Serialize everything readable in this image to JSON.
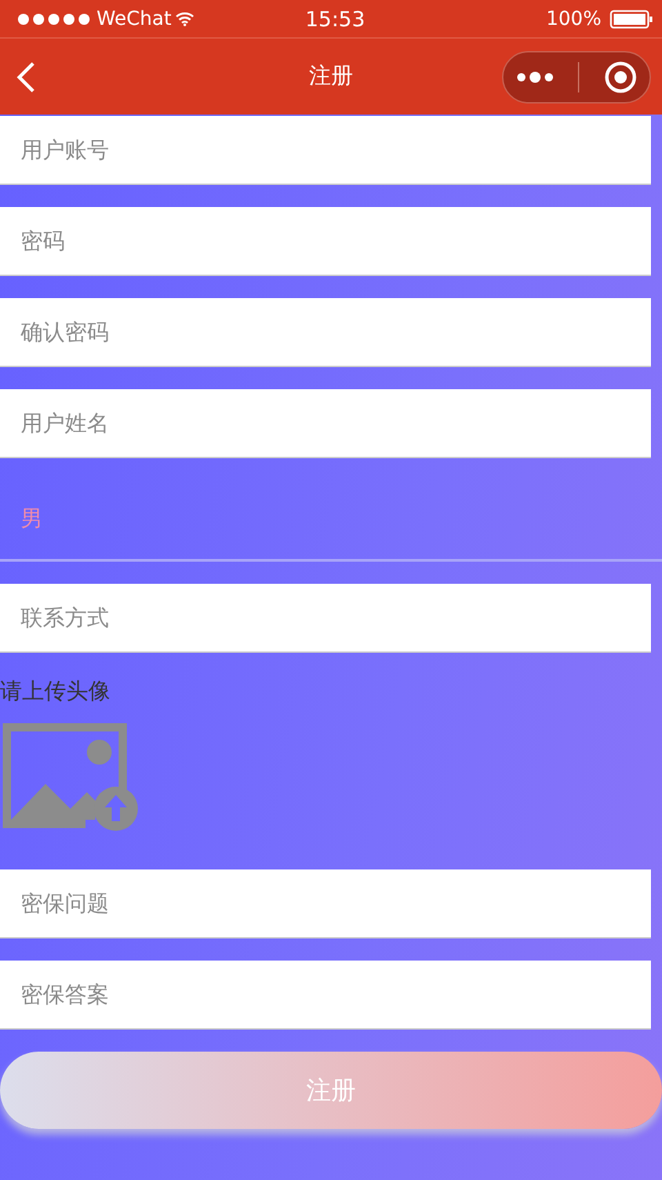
{
  "status_bar": {
    "carrier": "WeChat",
    "time": "15:53",
    "battery": "100%"
  },
  "nav_bar": {
    "title": "注册"
  },
  "fields": [
    {
      "kind": "input",
      "placeholder": "用户账号"
    },
    {
      "kind": "input",
      "placeholder": "密码"
    },
    {
      "kind": "input",
      "placeholder": "确认密码"
    },
    {
      "kind": "input",
      "placeholder": "用户姓名"
    },
    {
      "kind": "picker",
      "value": "男"
    },
    {
      "kind": "input",
      "placeholder": "联系方式"
    },
    {
      "kind": "upload",
      "label": "请上传头像"
    },
    {
      "kind": "input",
      "placeholder": "密保问题"
    },
    {
      "kind": "input",
      "placeholder": "密保答案"
    }
  ],
  "submit": {
    "label": "注册"
  }
}
